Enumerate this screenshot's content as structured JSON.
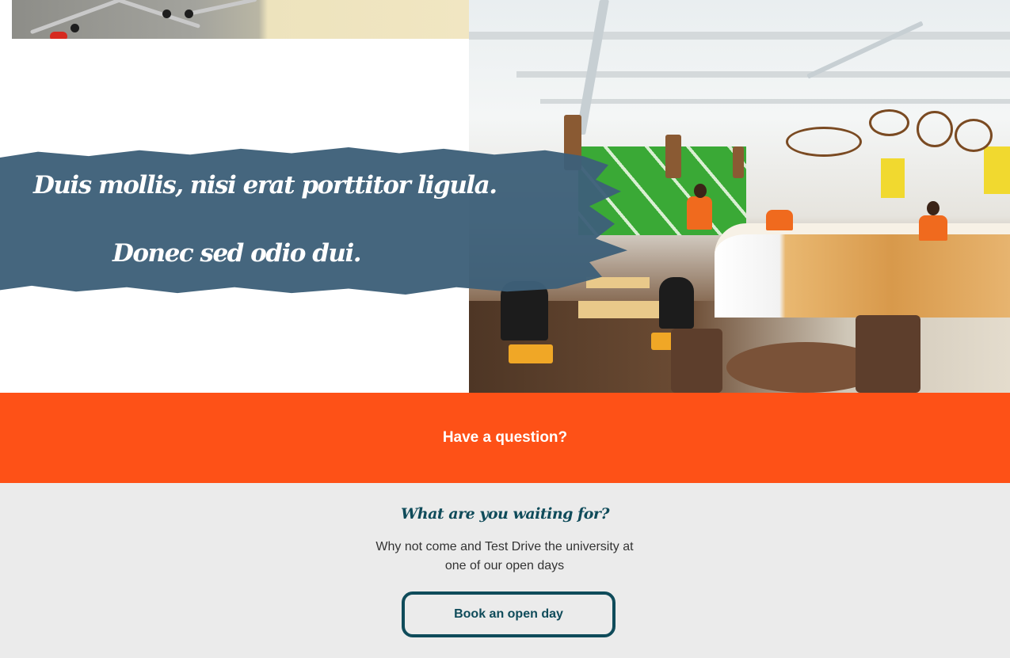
{
  "hero": {
    "banner_line_1": "Duis mollis, nisi erat porttitor ligula.",
    "banner_line_2": "Donec sed odio dui."
  },
  "question_bar": {
    "label": "Have a question?"
  },
  "cta": {
    "heading": "What are you waiting for?",
    "text": "Why not come and Test Drive the university at one of our open days",
    "button_label": "Book an open day"
  },
  "colors": {
    "banner_blue": "#3d6079",
    "accent_orange": "#fe5117",
    "teal": "#0f4b5a",
    "cta_background": "#ebebeb"
  }
}
